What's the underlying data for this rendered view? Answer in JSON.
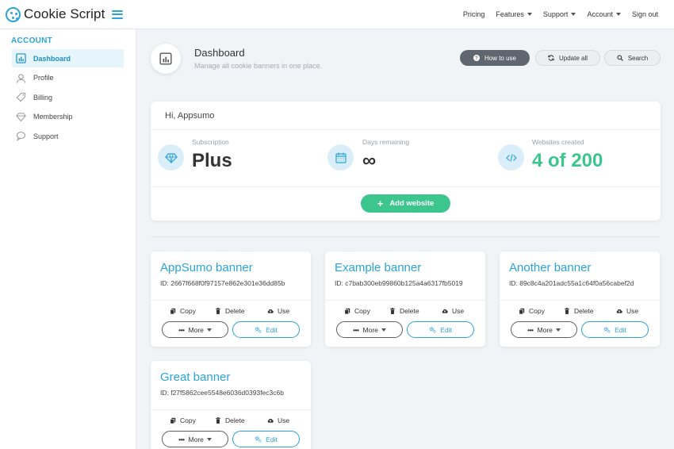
{
  "brand": {
    "name": "Cookie Script"
  },
  "topnav": [
    {
      "label": "Pricing",
      "caret": false
    },
    {
      "label": "Features",
      "caret": true
    },
    {
      "label": "Support",
      "caret": true
    },
    {
      "label": "Account",
      "caret": true
    },
    {
      "label": "Sign out",
      "caret": false
    }
  ],
  "sidebar": {
    "heading": "ACCOUNT",
    "items": [
      {
        "label": "Dashboard",
        "icon": "dashboard-icon"
      },
      {
        "label": "Profile",
        "icon": "user-icon"
      },
      {
        "label": "Billing",
        "icon": "tag-icon"
      },
      {
        "label": "Membership",
        "icon": "diamond-icon"
      },
      {
        "label": "Support",
        "icon": "chat-icon"
      }
    ]
  },
  "header": {
    "title": "Dashboard",
    "subtitle": "Manage all cookie banners in one place.",
    "how_to_use": "How to use",
    "update_all": "Update all",
    "search": "Search"
  },
  "summary": {
    "greeting": "Hi, Appsumo",
    "subscription_label": "Subscription",
    "subscription_value": "Plus",
    "days_label": "Days remaining",
    "days_value": "∞",
    "websites_label": "Websites created",
    "websites_value": "4 of 200",
    "add_website": "Add website"
  },
  "banners": [
    {
      "title": "AppSumo banner",
      "id": "ID: 2667f668f0f97157e862e301e36dd85b"
    },
    {
      "title": "Example banner",
      "id": "ID: c7bab300eb99860b125a4a6317fb5019"
    },
    {
      "title": "Another banner",
      "id": "ID: 89c8c4a201adc55a1c64f0a56cabef2d"
    },
    {
      "title": "Great banner",
      "id": "ID: f27f5862cee5548e6036d0393fec3c6b"
    }
  ],
  "banner_actions": {
    "copy": "Copy",
    "delete": "Delete",
    "use": "Use",
    "more": "More",
    "edit": "Edit"
  },
  "colors": {
    "accent": "#2aa4d9",
    "green": "#3cc58d",
    "dark": "#333333",
    "dark_button": "#5f6670"
  }
}
